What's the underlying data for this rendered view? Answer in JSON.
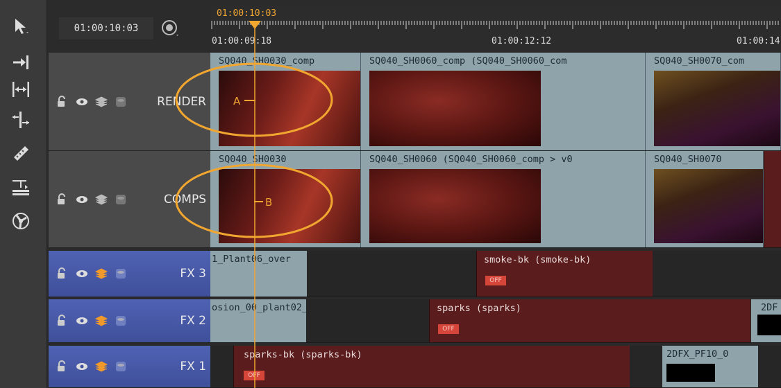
{
  "header": {
    "timecode": "01:00:10:03",
    "playhead_timecode": "01:00:10:03",
    "ruler_labels": [
      "01:00:09:18",
      "01:00:12:12",
      "01:00:14"
    ]
  },
  "tools": [
    "select-arrow-icon",
    "track-forward-icon",
    "slip-icon",
    "slide-icon",
    "razor-icon",
    "retime-icon",
    "audio-icon"
  ],
  "tracks": [
    {
      "name": "RENDER",
      "type": "video"
    },
    {
      "name": "COMPS",
      "type": "video"
    },
    {
      "name": "FX 3",
      "type": "effect"
    },
    {
      "name": "FX 2",
      "type": "effect"
    },
    {
      "name": "FX 1",
      "type": "effect"
    }
  ],
  "render_clips": [
    {
      "label": "SQ040_SH0030_comp"
    },
    {
      "label": "SQ040_SH0060_comp (SQ040_SH0060_com"
    },
    {
      "label": "SQ040_SH0070_com"
    }
  ],
  "comps_clips": [
    {
      "label": "SQ040_SH0030"
    },
    {
      "label": "SQ040_SH0060 (SQ040_SH0060_comp > v0"
    },
    {
      "label": "SQ040_SH0070"
    }
  ],
  "fx3_clips": [
    {
      "label": "1_Plant06_over"
    },
    {
      "label": "smoke-bk (smoke-bk)",
      "badge": "OFF"
    }
  ],
  "fx2_clips": [
    {
      "label": "osion_00_plant02_over"
    },
    {
      "label": "sparks (sparks)",
      "badge": "OFF"
    },
    {
      "label": "2DF"
    }
  ],
  "fx1_clips": [
    {
      "label": "sparks-bk (sparks-bk)",
      "badge": "OFF"
    },
    {
      "label": "2DFX_PF10_0"
    }
  ],
  "markers": [
    "A",
    "B"
  ],
  "colors": {
    "playhead": "#f1a630",
    "fx_clip": "#5a1c1c",
    "off_badge": "#d6453a",
    "video_clip": "#8fa3ab",
    "fx_track": "#4f62b3"
  }
}
